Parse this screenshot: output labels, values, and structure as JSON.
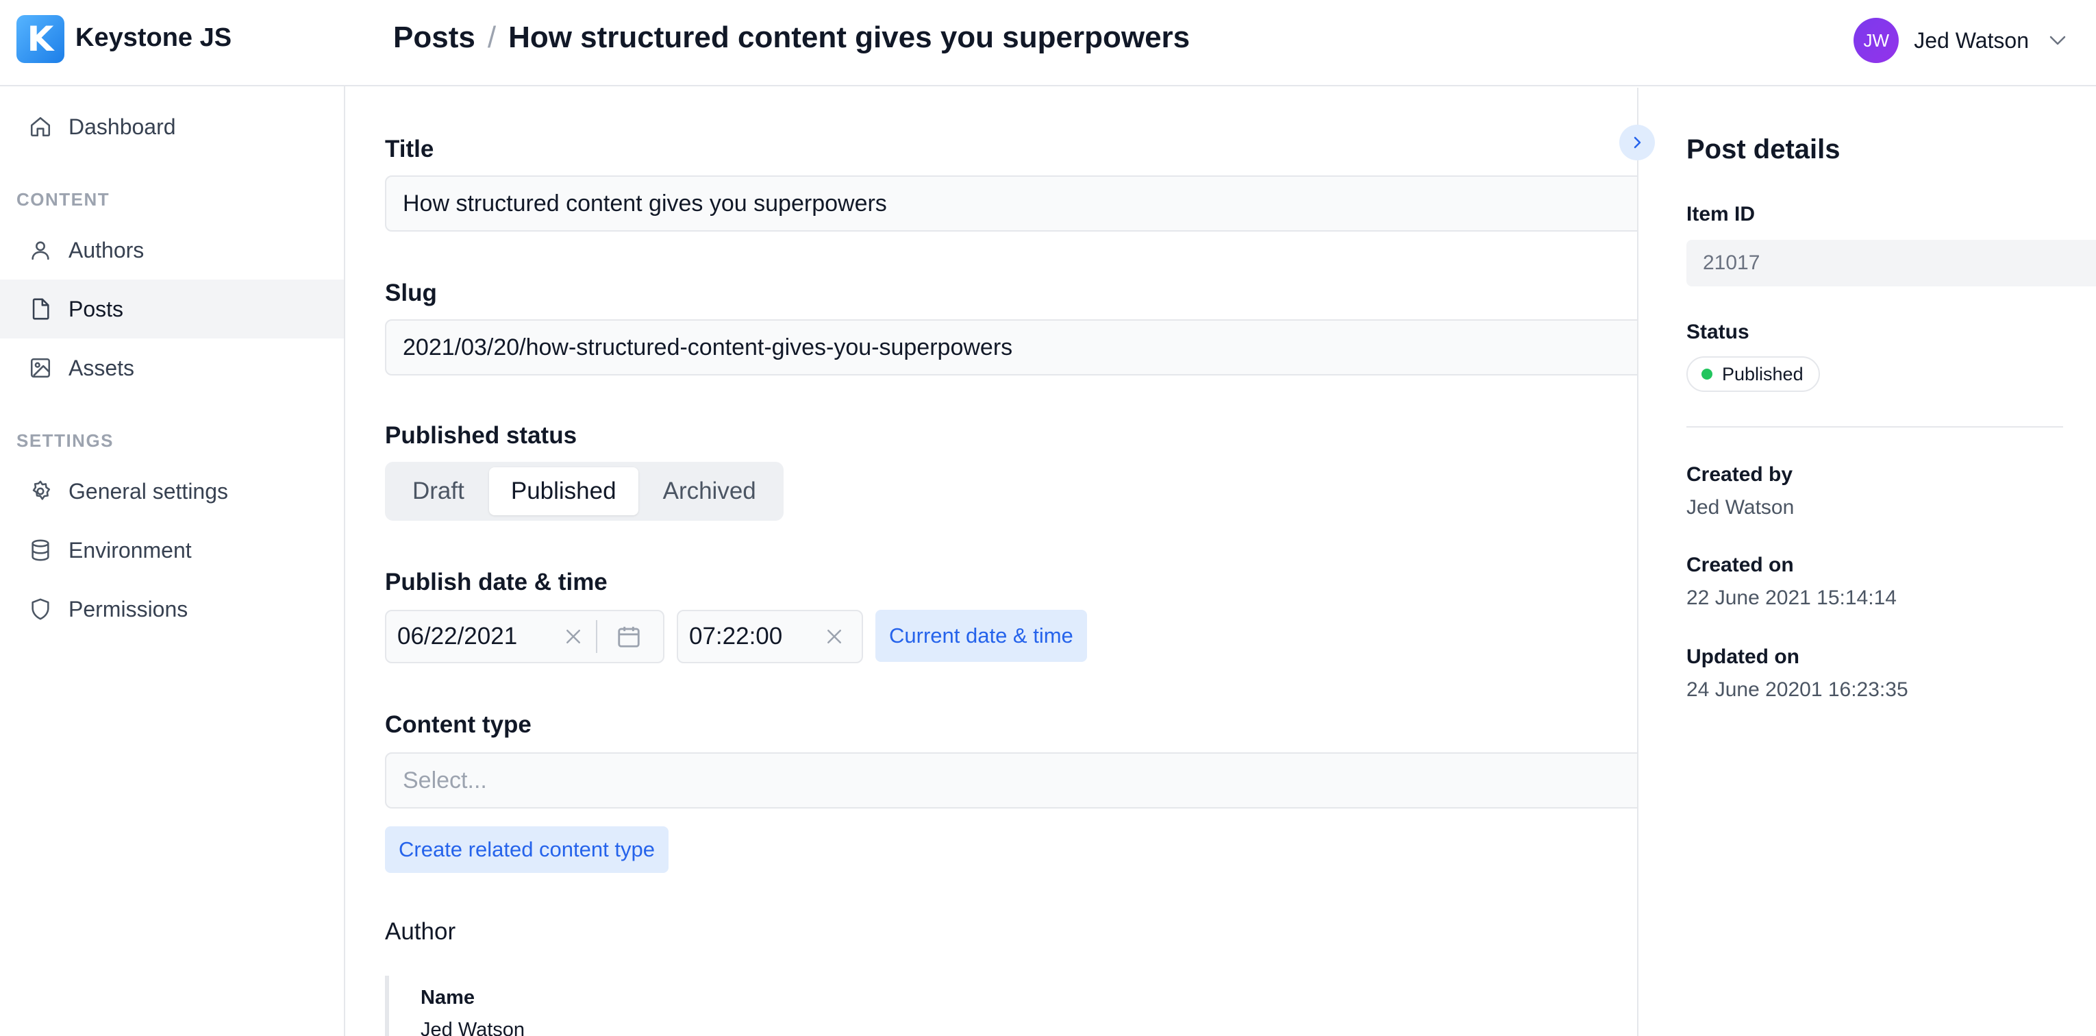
{
  "app": {
    "logo_letter": "K",
    "name": "Keystone JS"
  },
  "breadcrumb": {
    "section": "Posts",
    "separator": "/",
    "current": "How structured content gives you superpowers"
  },
  "user": {
    "initials": "JW",
    "name": "Jed Watson"
  },
  "sidebar": {
    "dashboard": "Dashboard",
    "content_heading": "CONTENT",
    "items": [
      {
        "label": "Authors",
        "icon": "user-icon"
      },
      {
        "label": "Posts",
        "icon": "file-icon",
        "active": true
      },
      {
        "label": "Assets",
        "icon": "image-icon"
      }
    ],
    "settings_heading": "SETTINGS",
    "settings_items": [
      {
        "label": "General settings",
        "icon": "gear-icon"
      },
      {
        "label": "Environment",
        "icon": "database-icon"
      },
      {
        "label": "Permissions",
        "icon": "shield-icon"
      }
    ]
  },
  "form": {
    "title_label": "Title",
    "title_value": "How structured content gives you superpowers",
    "slug_label": "Slug",
    "slug_value": "2021/03/20/how-structured-content-gives-you-superpowers",
    "status_label": "Published status",
    "status_options": [
      "Draft",
      "Published",
      "Archived"
    ],
    "status_selected": "Published",
    "publish_label": "Publish date & time",
    "date_value": "06/22/2021",
    "time_value": "07:22:00",
    "current_btn": "Current date & time",
    "content_type_label": "Content type",
    "content_type_placeholder": "Select...",
    "create_related_btn": "Create related content type",
    "author_label": "Author",
    "author_name_key": "Name",
    "author_name_value": "Jed Watson"
  },
  "details": {
    "title": "Post details",
    "item_id_label": "Item ID",
    "item_id": "21017",
    "status_label": "Status",
    "status": "Published",
    "created_by_label": "Created by",
    "created_by": "Jed Watson",
    "created_on_label": "Created on",
    "created_on": "22 June 2021 15:14:14",
    "updated_on_label": "Updated on",
    "updated_on": "24 June 20201 16:23:35"
  },
  "colors": {
    "accent": "#2563eb",
    "accent_soft": "#e0ecfd",
    "success": "#22c55e",
    "avatar": "#7c3aed"
  }
}
